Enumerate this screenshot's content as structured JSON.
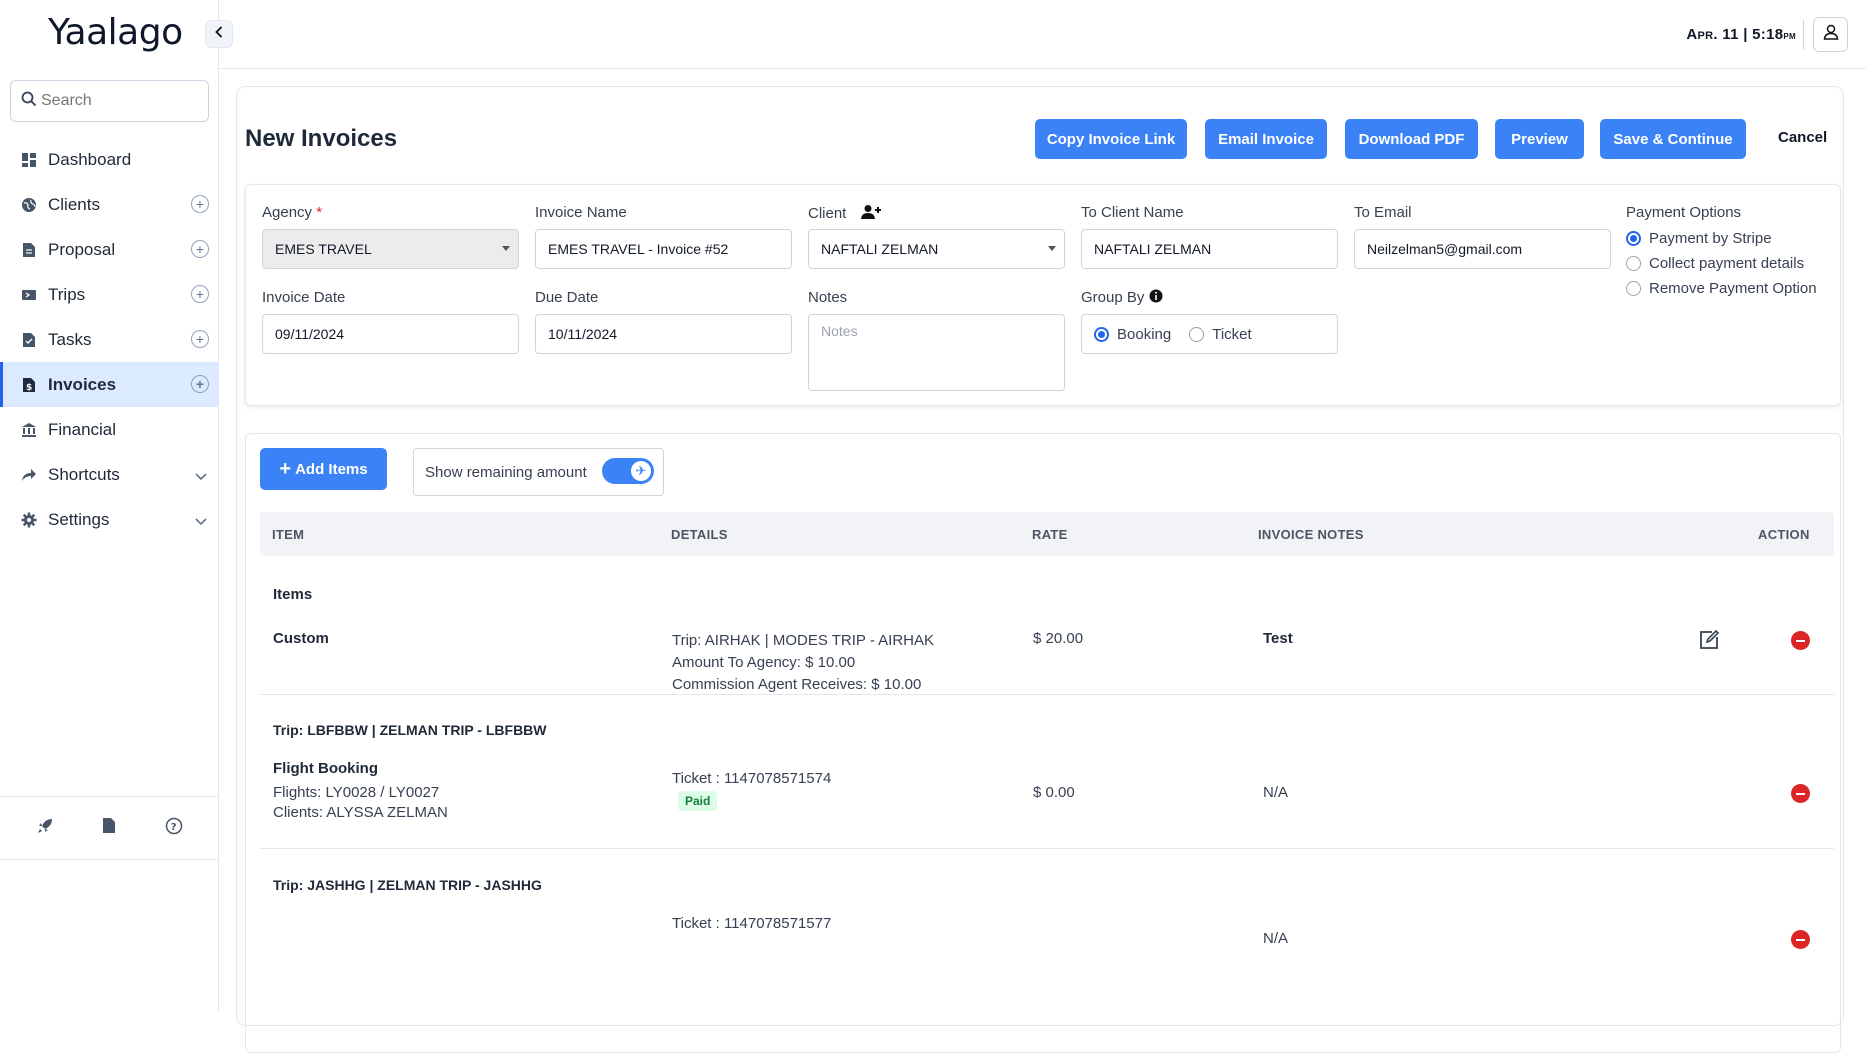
{
  "app": {
    "logo": "Yaalago"
  },
  "search": {
    "placeholder": "Search"
  },
  "sidebar": {
    "items": [
      {
        "label": "Dashboard"
      },
      {
        "label": "Clients"
      },
      {
        "label": "Proposal"
      },
      {
        "label": "Trips"
      },
      {
        "label": "Tasks"
      },
      {
        "label": "Invoices"
      },
      {
        "label": "Financial"
      },
      {
        "label": "Shortcuts"
      },
      {
        "label": "Settings"
      }
    ]
  },
  "topbar": {
    "date": "Apr. 11",
    "sep": "|",
    "time": "5:18",
    "ampm": "pm"
  },
  "page": {
    "title": "New Invoices"
  },
  "actions": {
    "copy_link": "Copy Invoice Link",
    "email": "Email Invoice",
    "download": "Download PDF",
    "preview": "Preview",
    "save": "Save & Continue",
    "cancel": "Cancel"
  },
  "form": {
    "agency_label": "Agency",
    "agency_value": "EMES TRAVEL",
    "invoice_name_label": "Invoice Name",
    "invoice_name_value": "EMES TRAVEL - Invoice #52",
    "client_label": "Client",
    "client_value": "NAFTALI ZELMAN",
    "to_client_name_label": "To Client Name",
    "to_client_name_value": "NAFTALI ZELMAN",
    "to_email_label": "To Email",
    "to_email_value": "Neilzelman5@gmail.com",
    "payment_options_label": "Payment Options",
    "payment_options": [
      "Payment by Stripe",
      "Collect payment details",
      "Remove Payment Option"
    ],
    "invoice_date_label": "Invoice Date",
    "invoice_date_value": "09/11/2024",
    "due_date_label": "Due Date",
    "due_date_value": "10/11/2024",
    "notes_label": "Notes",
    "notes_placeholder": "Notes",
    "group_by_label": "Group By",
    "group_by_options": [
      "Booking",
      "Ticket"
    ]
  },
  "items": {
    "add_label": "Add Items",
    "show_remaining": "Show remaining amount",
    "columns": [
      "ITEM",
      "DETAILS",
      "RATE",
      "INVOICE NOTES",
      "ACTION"
    ],
    "section_items": "Items",
    "custom": {
      "item": "Custom",
      "details": [
        "Trip: AIRHAK | MODES TRIP - AIRHAK",
        "Amount To Agency: $ 10.00",
        "Commission Agent Receives: $ 10.00"
      ],
      "rate": "$ 20.00",
      "notes": "Test"
    },
    "trip1": {
      "title": "Trip: LBFBBW | ZELMAN TRIP - LBFBBW",
      "item": "Flight Booking",
      "flights": "Flights: LY0028 / LY0027",
      "clients": "Clients: ALYSSA ZELMAN",
      "ticket": "Ticket : 1147078571574",
      "status": "Paid",
      "rate": "$ 0.00",
      "notes": "N/A"
    },
    "trip2": {
      "title": "Trip: JASHHG | ZELMAN TRIP - JASHHG",
      "ticket": "Ticket : 1147078571577",
      "notes": "N/A"
    }
  }
}
